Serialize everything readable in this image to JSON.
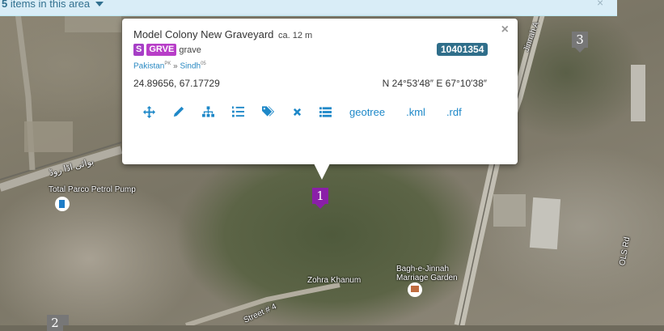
{
  "banner": {
    "count": "5",
    "text": "items in this area",
    "close": "×"
  },
  "popup": {
    "title": "Model Colony New Graveyard",
    "distance": "ca. 12 m",
    "badge_s": "S",
    "badge_grve": "GRVE",
    "feature_type": "grave",
    "id": "10401354",
    "country": "Pakistan",
    "country_code": "PK",
    "region_sep": "»",
    "province": "Sindh",
    "province_code": "05",
    "coords_decimal": "24.89656, 67.17729",
    "coords_dms": "N 24°53′48″ E 67°10′38″",
    "close": "×",
    "tools": [
      {
        "icon": "move-icon"
      },
      {
        "icon": "pencil-icon"
      },
      {
        "icon": "hierarchy-icon"
      },
      {
        "icon": "ordered-list-icon"
      },
      {
        "icon": "tags-icon"
      },
      {
        "icon": "delete-x-icon"
      },
      {
        "icon": "list-icon"
      }
    ],
    "links": [
      "geotree",
      ".kml",
      ".rdf"
    ]
  },
  "map": {
    "markers": [
      {
        "label": "1",
        "color": "#8a1fa8"
      },
      {
        "label": "3",
        "color": "#777777"
      },
      {
        "label": "2",
        "color": "#777777"
      }
    ],
    "labels": {
      "petrol": "Total Parco Petrol Pump",
      "urdu_road": "بوائی اڈا روڈ",
      "zohra": "Zohra Khanum",
      "bagh": "Bagh-e-Jinnah Marriage Garden",
      "street4": "Street # 4",
      "ols": "OLS Rd",
      "jinnah": "Jinnah A"
    }
  },
  "colors": {
    "banner_bg": "#d9edf7",
    "banner_text": "#31708f",
    "link": "#1e88c8",
    "id_badge": "#2f6e8a",
    "feature_badge": "#b83ec8"
  }
}
